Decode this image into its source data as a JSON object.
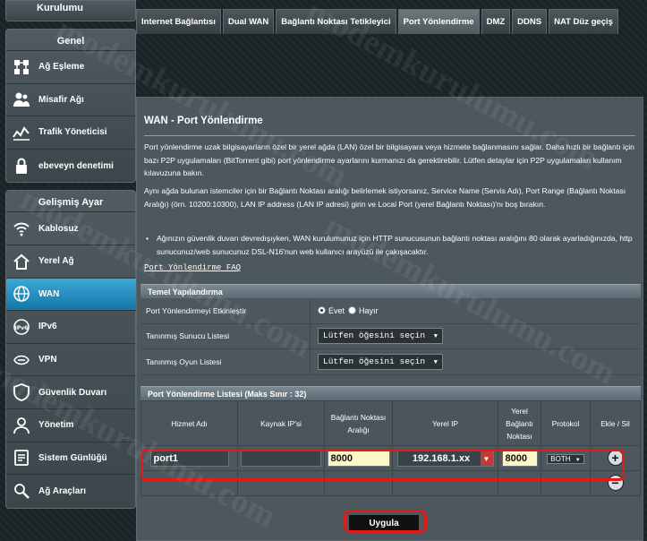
{
  "sidebar": {
    "top_item": "Kurulumu",
    "general_header": "Genel",
    "general_items": [
      {
        "label": "Ağ Eşleme",
        "icon": "network-map-icon"
      },
      {
        "label": "Misafir Ağı",
        "icon": "guest-network-icon"
      },
      {
        "label": "Trafik Yöneticisi",
        "icon": "traffic-manager-icon"
      },
      {
        "label": "ebeveyn denetimi",
        "icon": "parental-control-icon"
      }
    ],
    "advanced_header": "Gelişmiş Ayar",
    "advanced_items": [
      {
        "label": "Kablosuz",
        "icon": "wireless-icon"
      },
      {
        "label": "Yerel Ağ",
        "icon": "lan-icon"
      },
      {
        "label": "WAN",
        "icon": "wan-globe-icon",
        "active": true
      },
      {
        "label": "IPv6",
        "icon": "ipv6-icon"
      },
      {
        "label": "VPN",
        "icon": "vpn-icon"
      },
      {
        "label": "Güvenlik Duvarı",
        "icon": "firewall-icon"
      },
      {
        "label": "Yönetim",
        "icon": "administration-icon"
      },
      {
        "label": "Sistem Günlüğü",
        "icon": "system-log-icon"
      },
      {
        "label": "Ağ Araçları",
        "icon": "network-tools-icon"
      }
    ]
  },
  "tabs": [
    {
      "label": "Internet Bağlantısı"
    },
    {
      "label": "Dual WAN"
    },
    {
      "label": "Bağlantı Noktası Tetikleyici"
    },
    {
      "label": "Port Yönlendirme",
      "active": true
    },
    {
      "label": "DMZ"
    },
    {
      "label": "DDNS"
    },
    {
      "label": "NAT Düz geçiş"
    }
  ],
  "page": {
    "title": "WAN - Port Yönlendirme",
    "desc1": "Port yönlendirme uzak bilgisayarların özel bir yerel ağda (LAN) özel bir bilgisayara veya hizmete bağlanmasını sağlar. Daha hızlı bir bağlantı için bazı P2P uygulamaları (BitTorrent gibi) port yönlendirme ayarlarını kurmanızı da gerektirebilir. Lütfen detaylar için P2P uygulamaları kullanım kılavuzuna bakın.",
    "desc2": "Aynı ağda bulunan istemciler için bir Bağlantı Noktası aralığı belirlemek istiyorsanız, Service Name (Servis Adı), Port Range (Bağlantı Noktası Aralığı) (örn. 10200:10300), LAN IP address (LAN IP adresi) girin ve Local Port (yerel Bağlantı Noktası)'nı boş bırakın.",
    "bullet": "Ağınızın güvenlik duvarı devredışıyken, WAN kurulumunuz için HTTP sunucusunun bağlantı noktası aralığını 80 olarak ayarladığınızda, http sunucunuz/web sunucunuz DSL-N16'nun web kullanıcı arayüzü ile çakışacaktır.",
    "faq_link": "Port Yönlendirme FAQ"
  },
  "basic": {
    "header": "Temel Yapılandırma",
    "enable_label": "Port Yönlendirmeyi Etkinleştir",
    "yes": "Evet",
    "no": "Hayır",
    "server_label": "Tanınmış Sunucu Listesi",
    "server_select": "Lütfen öğesini seçin",
    "game_label": "Tanınmış Oyun Listesi",
    "game_select": "Lütfen öğesini seçin"
  },
  "list": {
    "header": "Port Yönlendirme Listesi (Maks Sınır : 32)",
    "col_service": "Hizmet Adı",
    "col_source": "Kaynak IP'si",
    "col_port_range_1": "Bağlantı Noktası",
    "col_port_range_2": "Aralığı",
    "col_local_ip": "Yerel IP",
    "col_local_port_1": "Yerel",
    "col_local_port_2": "Bağlantı",
    "col_local_port_3": "Noktası",
    "col_protocol": "Protokol",
    "col_addremove": "Ekle / Sil",
    "new_row": {
      "service": "port1",
      "source": "",
      "port_range": "8000",
      "local_ip": "192.168.1.xx",
      "local_port": "8000",
      "protocol": "BOTH"
    }
  },
  "apply_label": "Uygula",
  "watermark": "modemkurulumu.com"
}
